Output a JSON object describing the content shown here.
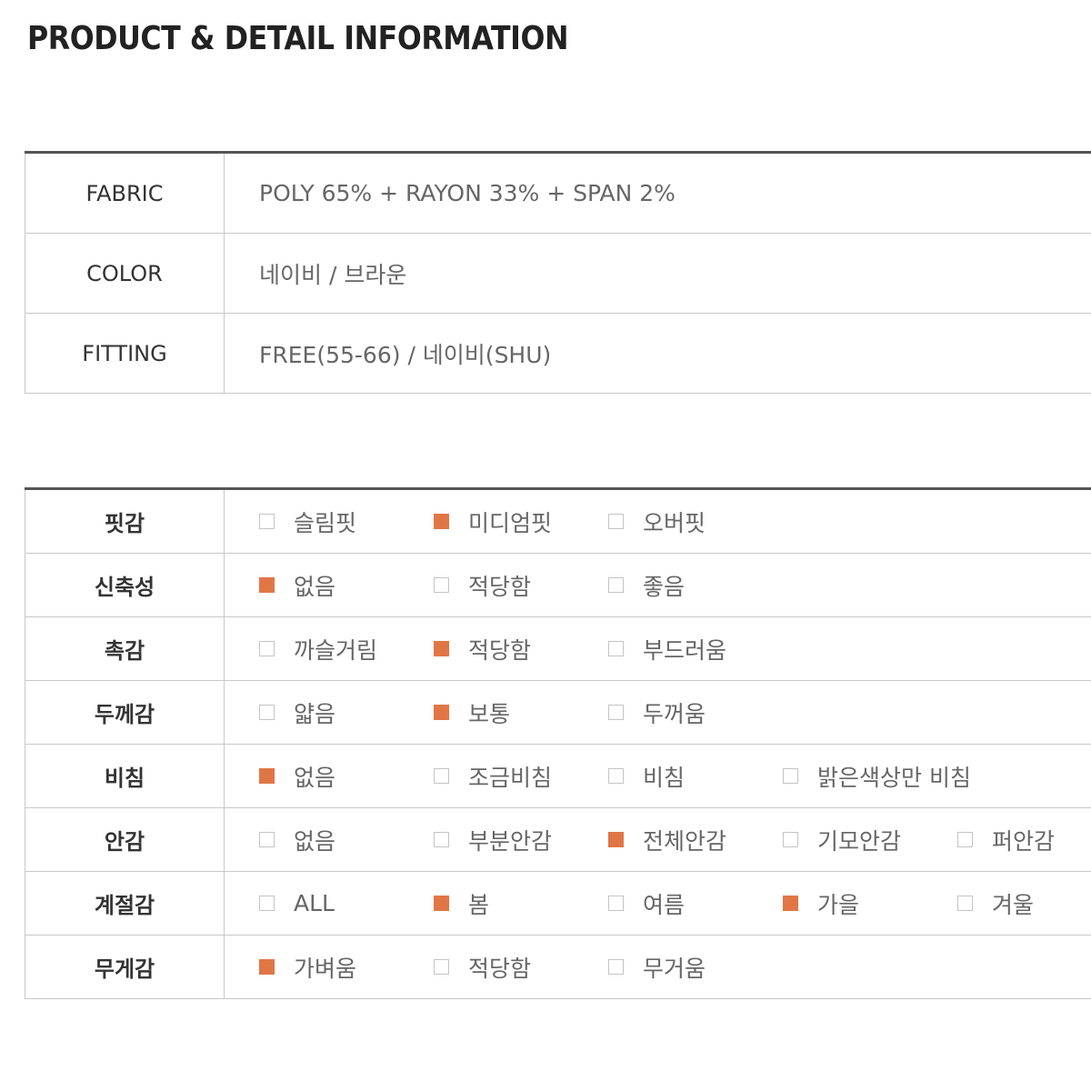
{
  "title": "PRODUCT & DETAIL INFORMATION",
  "accent_color": "#e07646",
  "spec": [
    {
      "label": "FABRIC",
      "value": "POLY 65% + RAYON 33% + SPAN 2%"
    },
    {
      "label": "COLOR",
      "value": "네이비 / 브라운"
    },
    {
      "label": "FITTING",
      "value": "FREE(55-66) / 네이비(SHU)"
    }
  ],
  "details": [
    {
      "label": "핏감",
      "options": [
        {
          "text": "슬림핏",
          "checked": false
        },
        {
          "text": "미디엄핏",
          "checked": true
        },
        {
          "text": "오버핏",
          "checked": false
        }
      ]
    },
    {
      "label": "신축성",
      "options": [
        {
          "text": "없음",
          "checked": true
        },
        {
          "text": "적당함",
          "checked": false
        },
        {
          "text": "좋음",
          "checked": false
        }
      ]
    },
    {
      "label": "촉감",
      "options": [
        {
          "text": "까슬거림",
          "checked": false
        },
        {
          "text": "적당함",
          "checked": true
        },
        {
          "text": "부드러움",
          "checked": false
        }
      ]
    },
    {
      "label": "두께감",
      "options": [
        {
          "text": "얇음",
          "checked": false
        },
        {
          "text": "보통",
          "checked": true
        },
        {
          "text": "두꺼움",
          "checked": false
        }
      ]
    },
    {
      "label": "비침",
      "options": [
        {
          "text": "없음",
          "checked": true
        },
        {
          "text": "조금비침",
          "checked": false
        },
        {
          "text": "비침",
          "checked": false
        },
        {
          "text": "밝은색상만 비침",
          "checked": false
        }
      ]
    },
    {
      "label": "안감",
      "options": [
        {
          "text": "없음",
          "checked": false
        },
        {
          "text": "부분안감",
          "checked": false
        },
        {
          "text": "전체안감",
          "checked": true
        },
        {
          "text": "기모안감",
          "checked": false
        },
        {
          "text": "퍼안감",
          "checked": false
        }
      ]
    },
    {
      "label": "계절감",
      "options": [
        {
          "text": "ALL",
          "checked": false
        },
        {
          "text": "봄",
          "checked": true
        },
        {
          "text": "여름",
          "checked": false
        },
        {
          "text": "가을",
          "checked": true
        },
        {
          "text": "겨울",
          "checked": false
        }
      ]
    },
    {
      "label": "무게감",
      "options": [
        {
          "text": "가벼움",
          "checked": true
        },
        {
          "text": "적당함",
          "checked": false
        },
        {
          "text": "무거움",
          "checked": false
        }
      ]
    }
  ]
}
